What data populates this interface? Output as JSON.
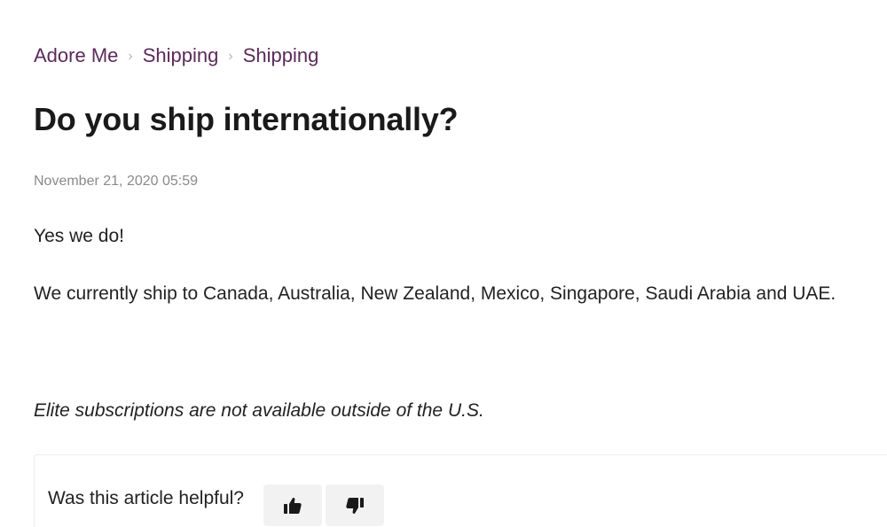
{
  "breadcrumb": {
    "items": [
      "Adore Me",
      "Shipping",
      "Shipping"
    ],
    "separator": "›"
  },
  "article": {
    "title": "Do you ship internationally?",
    "date": "November 21, 2020 05:59",
    "paragraphs": [
      "Yes we do!",
      "We currently ship to Canada, Australia, New Zealand, Mexico, Singapore, Saudi Arabia and UAE.",
      "Elite subscriptions are not available outside of the U.S."
    ]
  },
  "feedback": {
    "question": "Was this article helpful?",
    "up_icon": "thumbs-up-icon",
    "down_icon": "thumbs-down-icon"
  },
  "colors": {
    "brand": "#5b2a5a",
    "muted": "#8a8a8a",
    "button_bg": "#f2f2f2"
  }
}
